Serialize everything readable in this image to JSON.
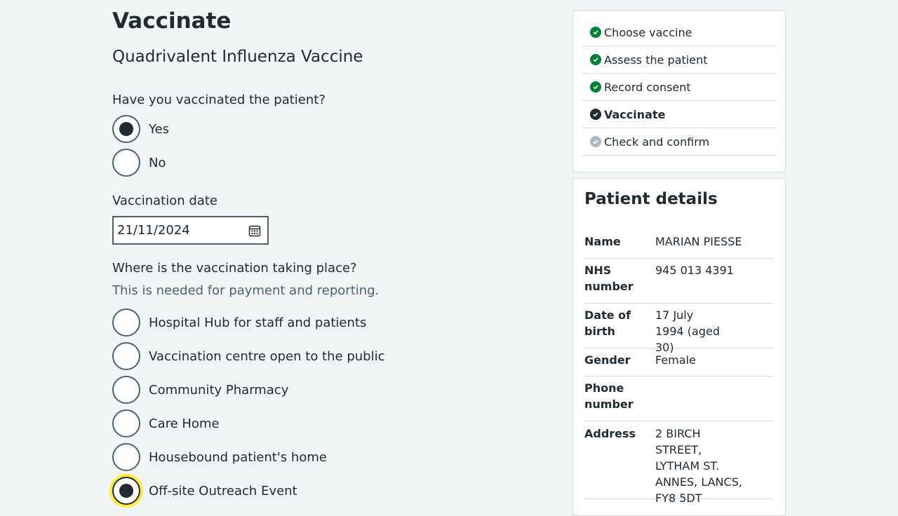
{
  "page": {
    "title": "Vaccinate",
    "vaccine_name": "Quadrivalent Influenza Vaccine"
  },
  "vaccinated_question": {
    "label": "Have you vaccinated the patient?",
    "options": [
      {
        "label": "Yes",
        "checked": true
      },
      {
        "label": "No",
        "checked": false
      }
    ]
  },
  "vaccination_date": {
    "label": "Vaccination date",
    "value": "21/11/2024",
    "icon": "calendar-icon"
  },
  "location_question": {
    "label": "Where is the vaccination taking place?",
    "hint": "This is needed for payment and reporting.",
    "options": [
      {
        "label": "Hospital Hub for staff and patients",
        "checked": false
      },
      {
        "label": "Vaccination centre open to the public",
        "checked": false
      },
      {
        "label": "Community Pharmacy",
        "checked": false
      },
      {
        "label": "Care Home",
        "checked": false
      },
      {
        "label": "Housebound patient's home",
        "checked": false
      },
      {
        "label": "Off-site Outreach Event",
        "checked": true,
        "focused": true
      }
    ]
  },
  "steps": [
    {
      "label": "Choose vaccine",
      "status": "complete",
      "icon": "check-circle-icon",
      "color": "#007f3b"
    },
    {
      "label": "Assess the patient",
      "status": "complete",
      "icon": "check-circle-icon",
      "color": "#007f3b"
    },
    {
      "label": "Record consent",
      "status": "complete",
      "icon": "check-circle-icon",
      "color": "#007f3b"
    },
    {
      "label": "Vaccinate",
      "status": "current",
      "icon": "check-circle-icon",
      "color": "#212b32"
    },
    {
      "label": "Check and confirm",
      "status": "pending",
      "icon": "check-circle-icon",
      "color": "#aeb7bd"
    }
  ],
  "patient_details": {
    "title": "Patient details",
    "rows": [
      {
        "key": "Name",
        "value": "MARIAN PIESSE"
      },
      {
        "key": "NHS number",
        "value": "945 013 4391"
      },
      {
        "key": "Date of birth",
        "value": "17 July 1994 (aged 30)"
      },
      {
        "key": "Gender",
        "value": "Female"
      },
      {
        "key": "Phone number",
        "value": ""
      },
      {
        "key": "Address",
        "value": "2 BIRCH STREET, LYTHAM ST. ANNES, LANCS, FY8 5DT"
      }
    ]
  },
  "colors": {
    "background": "#f0f4f5",
    "text": "#212b32",
    "secondary_text": "#4c6272",
    "complete": "#007f3b",
    "focus": "#ffeb3b"
  }
}
